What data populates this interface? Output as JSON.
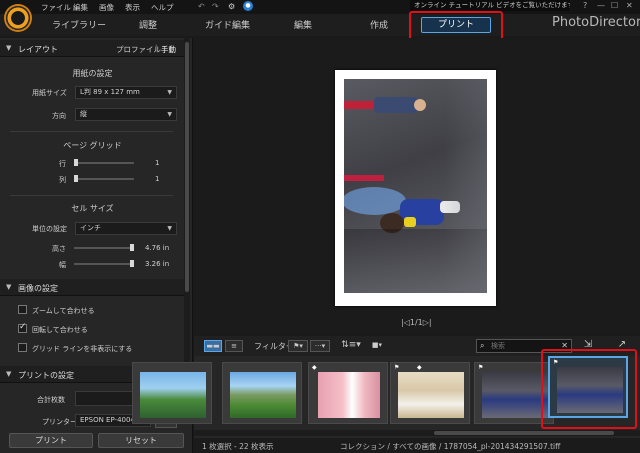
{
  "app": {
    "title": "PhotoDirector",
    "menus": [
      "ファイル",
      "編集",
      "画像",
      "表示",
      "ヘルプ"
    ],
    "notice": "オンライン チュートリアル ビデオをご覧いただけます。",
    "window_controls": [
      "?",
      "—",
      "☐",
      "✕"
    ]
  },
  "tabs": [
    "ライブラリー",
    "調整",
    "ガイド編集",
    "編集",
    "作成",
    "プリント"
  ],
  "left_panel": {
    "layout": {
      "title": "レイアウト",
      "profile_label": "プロファイル",
      "manual_label": "手動",
      "paper_settings": "用紙の設定",
      "paper_size_label": "用紙サイズ",
      "paper_size_value": "L判 89 x 127 mm",
      "orientation_label": "方向",
      "orientation_value": "縦",
      "page_grid": "ページ グリッド",
      "rows_label": "行",
      "rows_value": "1",
      "cols_label": "列",
      "cols_value": "1",
      "cell_size": "セル サイズ",
      "unit_label": "単位の設定",
      "unit_value": "インチ",
      "height_label": "高さ",
      "height_value": "4.76 in",
      "width_label": "幅",
      "width_value": "3.26 in"
    },
    "image_settings": {
      "title": "画像の設定",
      "options": [
        {
          "label": "ズームして合わせる",
          "checked": false
        },
        {
          "label": "回転して合わせる",
          "checked": true
        },
        {
          "label": "グリッド ラインを非表示にする",
          "checked": false
        }
      ]
    },
    "print_settings": {
      "title": "プリントの設定",
      "copies_label": "合計枚数",
      "copies_value": "1",
      "printer_label": "プリンター",
      "printer_value": "EPSON EP-4004"
    },
    "buttons": {
      "print": "プリント",
      "reset": "リセット"
    }
  },
  "preview": {
    "pager": "|◁1/1▷|"
  },
  "filmstrip": {
    "filter_label": "フィルター:",
    "search_placeholder": "検索",
    "thumbnails": [
      {
        "kind": "partial-landscape",
        "selected": false
      },
      {
        "kind": "mountain-valley",
        "selected": false
      },
      {
        "kind": "bride-pink",
        "selected": false
      },
      {
        "kind": "banquet-hall",
        "selected": false
      },
      {
        "kind": "kids-bubbles",
        "selected": false
      },
      {
        "kind": "kids-bubbles",
        "selected": true
      }
    ]
  },
  "status": {
    "selection": "1 枚選択 - 22 枚表示",
    "path": "コレクション / すべての画像 / 1787054_pl-201434291507.tiff"
  },
  "colors": {
    "accent": "#5aa6e6",
    "highlight": "#e0101a",
    "logo": "#f0a020"
  }
}
